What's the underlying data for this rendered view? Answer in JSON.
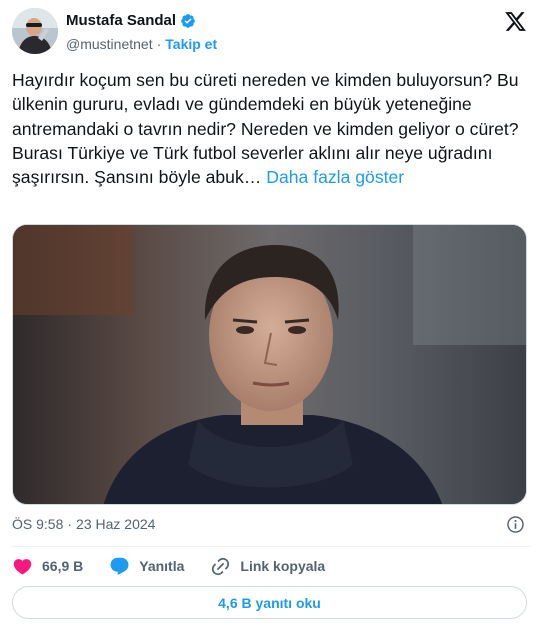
{
  "author": {
    "name": "Mustafa Sandal",
    "handle": "@mustinetnet",
    "separator": "·",
    "follow_label": "Takip et"
  },
  "tweet": {
    "text": "Hayırdır koçum sen bu cüreti nereden ve kimden buluyorsun? Bu ülkenin gururu, evladı ve gündemdeki en büyük yeteneğine antremandaki o tavrın nedir? Nereden ve kimden geliyor o cüret? Burası Türkiye ve Türk futbol severler aklını alır neye uğradını şaşırırsın. Şansını böyle abuk…",
    "show_more_label": "Daha fazla göster"
  },
  "meta": {
    "time": "ÖS 9:58",
    "separator": "·",
    "date": "23 Haz 2024"
  },
  "actions": {
    "likes": "66,9 B",
    "reply_label": "Yanıtla",
    "copy_link_label": "Link kopyala"
  },
  "replies_button_label": "4,6 B yanıtı oku",
  "icons": {
    "verified": "verified-badge-icon",
    "logo": "x-logo-icon",
    "info": "info-icon",
    "like": "heart-icon",
    "reply": "speech-bubble-icon",
    "link": "link-icon"
  },
  "colors": {
    "accent": "#1d9bf0",
    "like": "#f91880",
    "text": "#0f1419",
    "secondary": "#536471"
  }
}
